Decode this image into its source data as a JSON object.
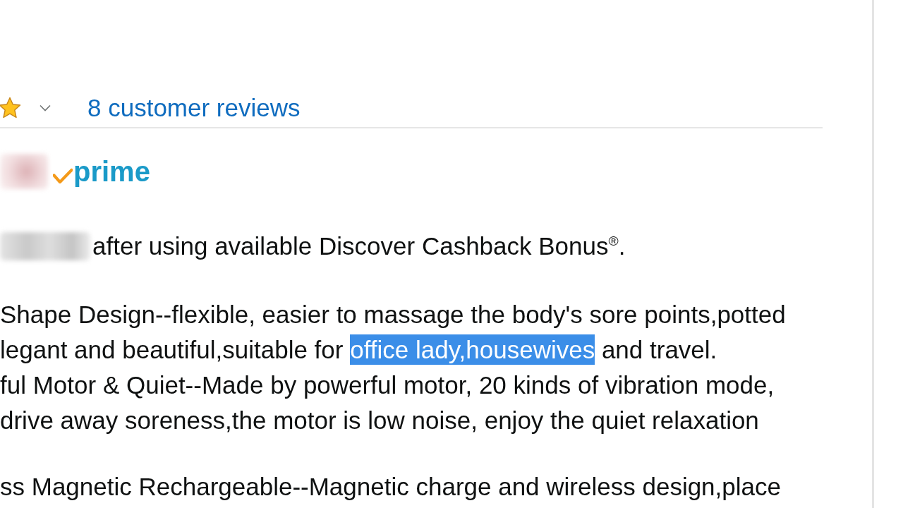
{
  "reviews": {
    "link": "8 customer reviews"
  },
  "prime": {
    "label": "prime"
  },
  "cashback": {
    "text": "after using available Discover Cashback Bonus$^{®}$."
  },
  "description_blocks": [
    {
      "lines": [
        {
          "segments": [
            {
              "text": "Shape Design--flexible, easier to massage the body's sore points,potted",
              "selected": false
            }
          ]
        },
        {
          "segments": [
            {
              "text": "legant and beautiful,suitable for ",
              "selected": false
            },
            {
              "text": "office lady,housewives",
              "selected": true
            },
            {
              "text": " and travel.",
              "selected": false
            }
          ]
        },
        {
          "segments": [
            {
              "text": "ful Motor & Quiet--Made by powerful motor, 20 kinds of vibration mode,",
              "selected": false
            }
          ]
        },
        {
          "segments": [
            {
              "text": "drive away soreness,the motor is low noise, enjoy the quiet relaxation",
              "selected": false
            }
          ]
        }
      ]
    },
    {
      "lines": [
        {
          "segments": [
            {
              "text": "ss Magnetic Rechargeable--Magnetic charge and wireless design,place",
              "selected": false
            }
          ]
        }
      ]
    }
  ]
}
